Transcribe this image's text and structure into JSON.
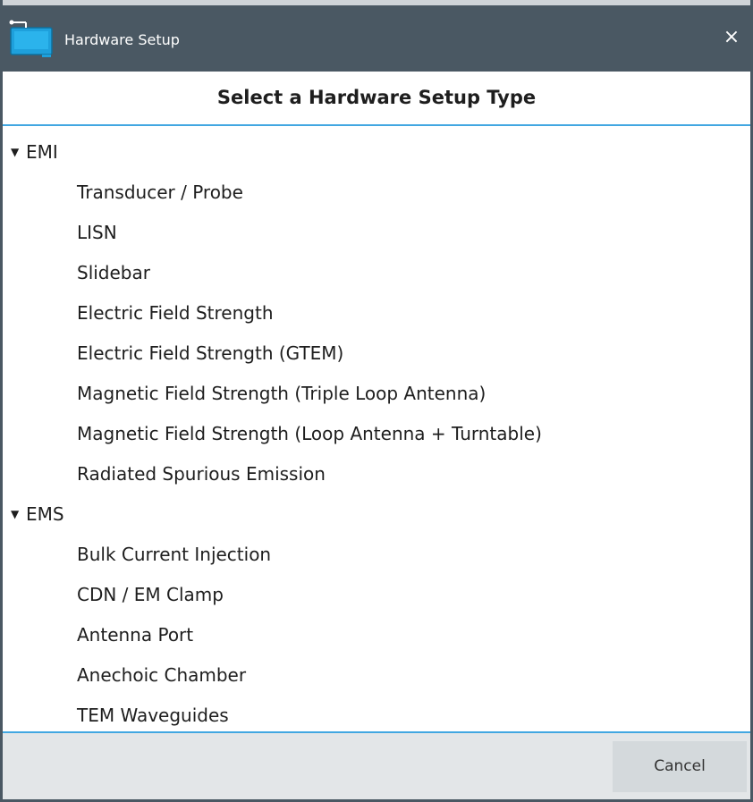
{
  "window": {
    "title": "Hardware Setup",
    "close_glyph": "×",
    "icon": "hardware-setup-app-icon",
    "accent_color": "#41a7e1",
    "titlebar_color": "#4a5863"
  },
  "header": {
    "title": "Select a Hardware Setup Type"
  },
  "tree": {
    "groups": [
      {
        "label": "EMI",
        "expanded": true,
        "items": [
          "Transducer / Probe",
          "LISN",
          "Slidebar",
          "Electric Field Strength",
          "Electric Field Strength (GTEM)",
          "Magnetic Field Strength (Triple Loop Antenna)",
          "Magnetic Field Strength (Loop Antenna + Turntable)",
          "Radiated Spurious Emission"
        ]
      },
      {
        "label": "EMS",
        "expanded": true,
        "items": [
          "Bulk Current Injection",
          "CDN / EM Clamp",
          "Antenna Port",
          "Anechoic Chamber",
          "TEM Waveguides"
        ]
      }
    ]
  },
  "footer": {
    "cancel_label": "Cancel"
  }
}
